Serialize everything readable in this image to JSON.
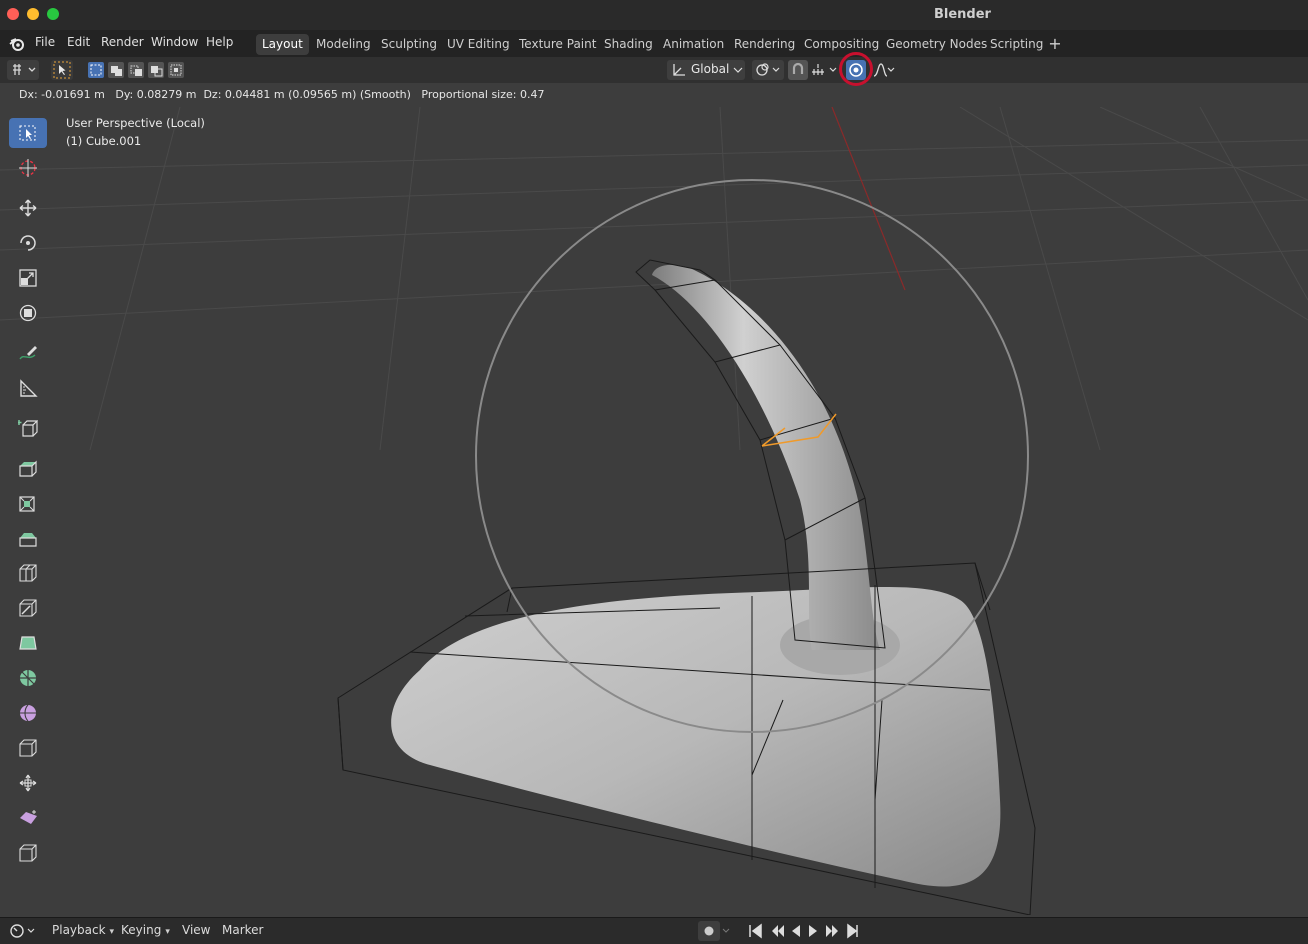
{
  "window": {
    "title": "Blender"
  },
  "menu": [
    "File",
    "Edit",
    "Render",
    "Window",
    "Help"
  ],
  "workspaces": [
    "Layout",
    "Modeling",
    "Sculpting",
    "UV Editing",
    "Texture Paint",
    "Shading",
    "Animation",
    "Rendering",
    "Compositing",
    "Geometry Nodes",
    "Scripting"
  ],
  "active_workspace": "Layout",
  "header": {
    "transform_orientation": "Global",
    "proportional_editing_icon": "proportional-editing-icon",
    "highlight_color": "#c8102e"
  },
  "status": {
    "dx": "Dx: -0.01691 m",
    "dy": "Dy: 0.08279 m",
    "dz": "Dz: 0.04481 m (0.09565 m) (Smooth)",
    "proportional": "Proportional size: 0.47"
  },
  "viewport": {
    "perspective": "User Perspective (Local)",
    "object": "(1) Cube.001"
  },
  "tools": [
    "select-box-icon",
    "cursor-icon",
    "move-icon",
    "rotate-icon",
    "scale-icon",
    "transform-icon",
    "annotate-icon",
    "measure-icon",
    "add-cube-icon",
    "extrude-icon",
    "inset-icon",
    "bevel-icon",
    "loop-cut-icon",
    "knife-icon",
    "poly-build-icon",
    "spin-icon",
    "smooth-icon",
    "edge-slide-icon",
    "shrink-fatten-icon",
    "shear-icon",
    "rip-icon"
  ],
  "timeline": {
    "playback": "Playback",
    "keying": "Keying",
    "view": "View",
    "marker": "Marker"
  }
}
